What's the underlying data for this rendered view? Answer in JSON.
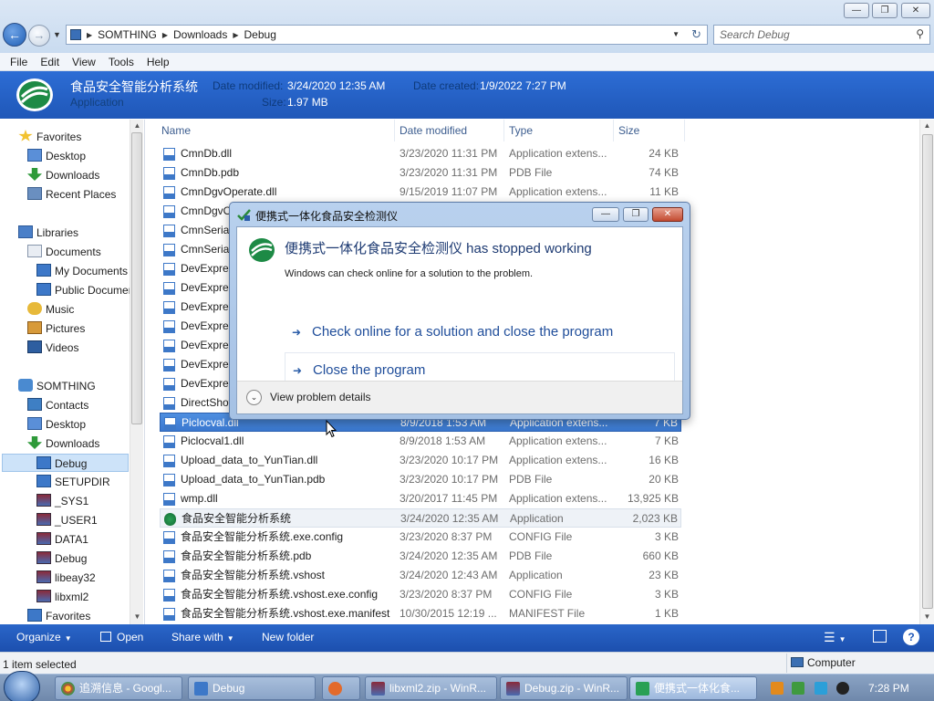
{
  "window": {
    "controls": {
      "minimize": "—",
      "maximize": "❐",
      "close": "✕"
    }
  },
  "address": {
    "crumbs": [
      "SOMTHING",
      "Downloads",
      "Debug"
    ],
    "search_placeholder": "Search Debug"
  },
  "menu": [
    "File",
    "Edit",
    "View",
    "Tools",
    "Help"
  ],
  "details": {
    "name": "食品安全智能分析系统",
    "kind": "Application",
    "date_modified_label": "Date modified:",
    "date_modified": "3/24/2020 12:35 AM",
    "size_label": "Size:",
    "size": "1.97 MB",
    "date_created_label": "Date created:",
    "date_created": "1/9/2022 7:27 PM"
  },
  "nav": [
    {
      "label": "Favorites",
      "icon": "star-icon"
    },
    {
      "label": "Desktop",
      "icon": "desktop-icon"
    },
    {
      "label": "Downloads",
      "icon": "downloads-icon"
    },
    {
      "label": "Recent Places",
      "icon": "recent-places-icon"
    },
    {
      "label": "Libraries",
      "icon": "libraries-icon"
    },
    {
      "label": "Documents",
      "icon": "documents-icon"
    },
    {
      "label": "My Documents",
      "icon": "folder-icon"
    },
    {
      "label": "Public Documents",
      "icon": "folder-icon"
    },
    {
      "label": "Music",
      "icon": "music-icon"
    },
    {
      "label": "Pictures",
      "icon": "pictures-icon"
    },
    {
      "label": "Videos",
      "icon": "videos-icon"
    },
    {
      "label": "SOMTHING",
      "icon": "user-icon"
    },
    {
      "label": "Contacts",
      "icon": "contacts-icon"
    },
    {
      "label": "Desktop",
      "icon": "desktop-icon"
    },
    {
      "label": "Downloads",
      "icon": "downloads-icon"
    },
    {
      "label": "Debug",
      "icon": "folder-icon"
    },
    {
      "label": "SETUPDIR",
      "icon": "folder-icon"
    },
    {
      "label": "_SYS1",
      "icon": "archive-icon"
    },
    {
      "label": "_USER1",
      "icon": "archive-icon"
    },
    {
      "label": "DATA1",
      "icon": "archive-icon"
    },
    {
      "label": "Debug",
      "icon": "archive-icon"
    },
    {
      "label": "libeay32",
      "icon": "archive-icon"
    },
    {
      "label": "libxml2",
      "icon": "archive-icon"
    },
    {
      "label": "Favorites",
      "icon": "folder-icon"
    }
  ],
  "columns": {
    "name": "Name",
    "date": "Date modified",
    "type": "Type",
    "size": "Size"
  },
  "files": [
    {
      "name": "CmnDb.dll",
      "date": "3/23/2020 11:31 PM",
      "type": "Application extens...",
      "size": "24 KB"
    },
    {
      "name": "CmnDb.pdb",
      "date": "3/23/2020 11:31 PM",
      "type": "PDB File",
      "size": "74 KB"
    },
    {
      "name": "CmnDgvOperate.dll",
      "date": "9/15/2019 11:07 PM",
      "type": "Application extens...",
      "size": "11 KB"
    },
    {
      "name": "CmnDgvO",
      "date": "",
      "type": "",
      "size": ""
    },
    {
      "name": "CmnSerial",
      "date": "",
      "type": "",
      "size": ""
    },
    {
      "name": "CmnSerial",
      "date": "",
      "type": "",
      "size": ""
    },
    {
      "name": "DevExpres",
      "date": "",
      "type": "",
      "size": ""
    },
    {
      "name": "DevExpres",
      "date": "",
      "type": "",
      "size": ""
    },
    {
      "name": "DevExpres",
      "date": "",
      "type": "",
      "size": ""
    },
    {
      "name": "DevExpres",
      "date": "",
      "type": "",
      "size": ""
    },
    {
      "name": "DevExpres",
      "date": "",
      "type": "",
      "size": ""
    },
    {
      "name": "DevExpres",
      "date": "",
      "type": "",
      "size": ""
    },
    {
      "name": "DevExpres",
      "date": "",
      "type": "",
      "size": ""
    },
    {
      "name": "DirectShow",
      "date": "",
      "type": "",
      "size": ""
    },
    {
      "name": "Piclocval.dll",
      "date": "8/9/2018 1:53 AM",
      "type": "Application extens...",
      "size": "7 KB"
    },
    {
      "name": "Piclocval1.dll",
      "date": "8/9/2018 1:53 AM",
      "type": "Application extens...",
      "size": "7 KB"
    },
    {
      "name": "Upload_data_to_YunTian.dll",
      "date": "3/23/2020 10:17 PM",
      "type": "Application extens...",
      "size": "16 KB"
    },
    {
      "name": "Upload_data_to_YunTian.pdb",
      "date": "3/23/2020 10:17 PM",
      "type": "PDB File",
      "size": "20 KB"
    },
    {
      "name": "wmp.dll",
      "date": "3/20/2017 11:45 PM",
      "type": "Application extens...",
      "size": "13,925 KB"
    },
    {
      "name": "食品安全智能分析系统",
      "date": "3/24/2020 12:35 AM",
      "type": "Application",
      "size": "2,023 KB"
    },
    {
      "name": "食品安全智能分析系统.exe.config",
      "date": "3/23/2020 8:37 PM",
      "type": "CONFIG File",
      "size": "3 KB"
    },
    {
      "name": "食品安全智能分析系统.pdb",
      "date": "3/24/2020 12:35 AM",
      "type": "PDB File",
      "size": "660 KB"
    },
    {
      "name": "食品安全智能分析系统.vshost",
      "date": "3/24/2020 12:43 AM",
      "type": "Application",
      "size": "23 KB"
    },
    {
      "name": "食品安全智能分析系统.vshost.exe.config",
      "date": "3/23/2020 8:37 PM",
      "type": "CONFIG File",
      "size": "3 KB"
    },
    {
      "name": "食品安全智能分析系统.vshost.exe.manifest",
      "date": "10/30/2015 12:19 ...",
      "type": "MANIFEST File",
      "size": "1 KB"
    }
  ],
  "commands": {
    "organize": "Organize",
    "open": "Open",
    "share_with": "Share with",
    "new_folder": "New folder"
  },
  "status": {
    "selection": "1 item selected",
    "location": "Computer"
  },
  "taskbar": [
    {
      "label": "追溯信息 - Googl...",
      "icon": "chrome-icon"
    },
    {
      "label": "Debug",
      "icon": "explorer-icon"
    },
    {
      "label": "",
      "icon": "media-player-icon"
    },
    {
      "label": "libxml2.zip - WinR...",
      "icon": "winrar-icon"
    },
    {
      "label": "Debug.zip - WinR...",
      "icon": "winrar-icon"
    },
    {
      "label": "便携式一体化食...",
      "icon": "app-icon"
    }
  ],
  "clock": "7:28 PM",
  "dialog": {
    "title": "便携式一体化食品安全检测仪",
    "heading": "便携式一体化食品安全检测仪 has stopped working",
    "subtext": "Windows can check online for a solution to the problem.",
    "option_check": "Check online for a solution and close the program",
    "option_close": "Close the program",
    "details": "View problem details"
  },
  "colors": {
    "accent": "#1f57b8",
    "selection": "#3a78d0",
    "link": "#1f4d9a"
  }
}
